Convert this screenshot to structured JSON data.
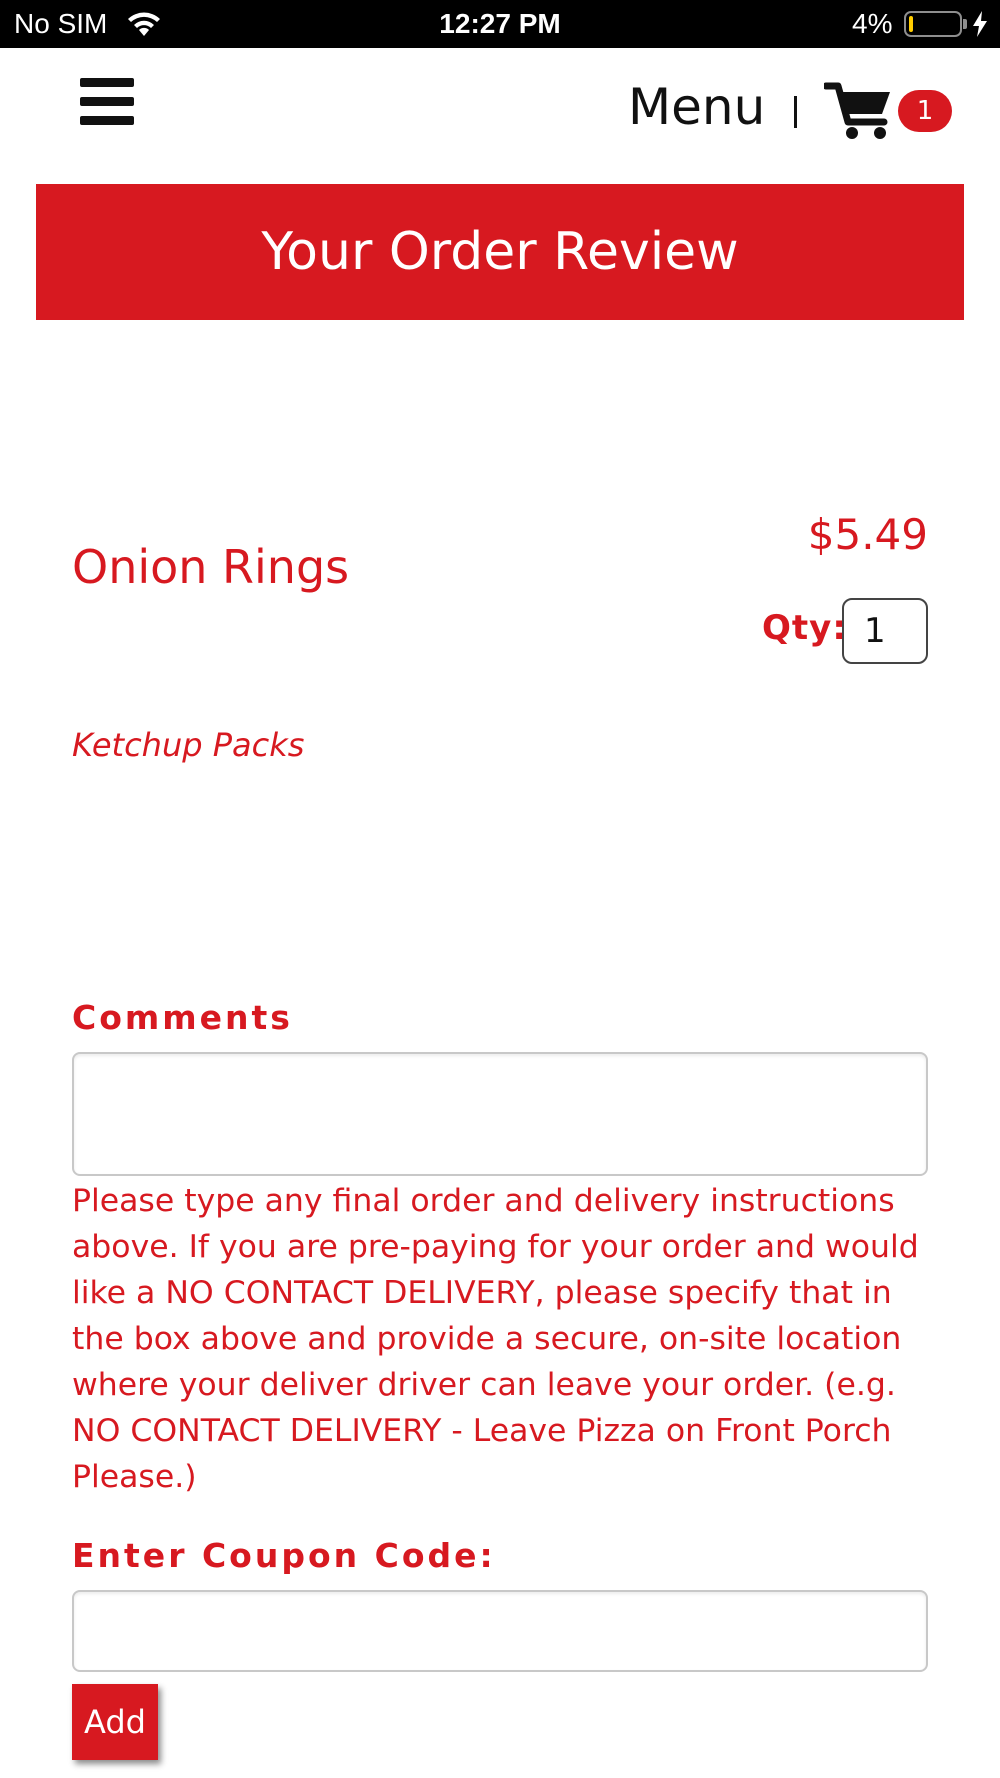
{
  "status_bar": {
    "carrier": "No SIM",
    "time": "12:27 PM",
    "battery_percent": "4%",
    "icons": [
      "wifi-icon",
      "battery-icon",
      "charging-bolt-icon"
    ]
  },
  "header": {
    "menu_icon": "hamburger-icon",
    "menu_label": "Menu",
    "cart_icon": "cart-icon",
    "cart_count": "1"
  },
  "banner": {
    "title": "Your Order Review"
  },
  "order": {
    "item_name": "Onion Rings",
    "price": "$5.49",
    "qty_label": "Qty:",
    "qty_value": "1",
    "option": "Ketchup Packs"
  },
  "comments": {
    "label": "Comments",
    "value": "",
    "instructions": "Please type any final order and delivery instructions above. If you are pre-paying for your order and would like a NO CONTACT DELIVERY, please specify that in the box above and provide a secure, on-site location where your deliver driver can leave your order. (e.g. NO CONTACT DELIVERY - Leave Pizza on Front Porch Please.)"
  },
  "coupon": {
    "label": "Enter Coupon Code:",
    "value": "",
    "add_label": "Add"
  },
  "colors": {
    "accent": "#d71920",
    "status_bar_bg": "#000000",
    "text_dark": "#111111"
  }
}
